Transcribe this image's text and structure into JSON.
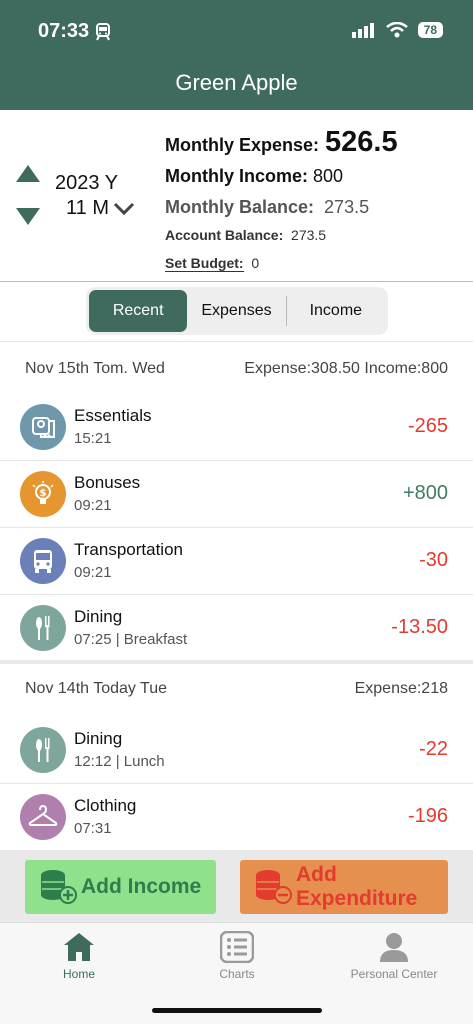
{
  "status": {
    "time": "07:33",
    "battery": "78"
  },
  "header": {
    "title": "Green Apple"
  },
  "summary": {
    "year": "2023 Y",
    "month": "11 M",
    "monthly_expense_label": "Monthly Expense:",
    "monthly_expense_value": "526.5",
    "monthly_income_label": "Monthly Income:",
    "monthly_income_value": "800",
    "monthly_balance_label": "Monthly Balance:",
    "monthly_balance_value": "273.5",
    "account_balance_label": "Account Balance:",
    "account_balance_value": "273.5",
    "set_budget_label": "Set Budget:",
    "set_budget_value": "0"
  },
  "tabs": [
    {
      "label": "Recent"
    },
    {
      "label": "Expenses"
    },
    {
      "label": "Income"
    }
  ],
  "days": [
    {
      "date": "Nov 15th Tom.  Wed",
      "totals": "Expense:308.50 Income:800",
      "entries": [
        {
          "name": "Essentials",
          "sub": "15:21",
          "amount": "-265",
          "icon": "toilet-paper-icon",
          "color": "#6f98ad"
        },
        {
          "name": "Bonuses",
          "sub": "09:21",
          "amount": "+800",
          "icon": "lightbulb-dollar-icon",
          "color": "#e5962f"
        },
        {
          "name": "Transportation",
          "sub": "09:21",
          "amount": "-30",
          "icon": "bus-icon",
          "color": "#6b7fb8"
        },
        {
          "name": "Dining",
          "sub": "07:25 | Breakfast",
          "amount": "-13.50",
          "icon": "cutlery-icon",
          "color": "#7fa69c"
        }
      ]
    },
    {
      "date": "Nov 14th Today  Tue",
      "totals": "Expense:218",
      "entries": [
        {
          "name": "Dining",
          "sub": "12:12 | Lunch",
          "amount": "-22",
          "icon": "cutlery-icon",
          "color": "#7fa69c"
        },
        {
          "name": "Clothing",
          "sub": "07:31",
          "amount": "-196",
          "icon": "hanger-icon",
          "color": "#b07fae"
        }
      ]
    }
  ],
  "actions": {
    "add_income": "Add Income",
    "add_expenditure_1": "Add",
    "add_expenditure_2": "Expenditure"
  },
  "tabbar": [
    {
      "label": "Home",
      "icon": "home-icon"
    },
    {
      "label": "Charts",
      "icon": "list-icon"
    },
    {
      "label": "Personal Center",
      "icon": "person-icon"
    }
  ],
  "colors": {
    "accent": "#3f6b5f",
    "expense": "#e33b2e",
    "income": "#3f7d5f",
    "income_button": "#8fe18b",
    "expense_button": "#e69050"
  }
}
